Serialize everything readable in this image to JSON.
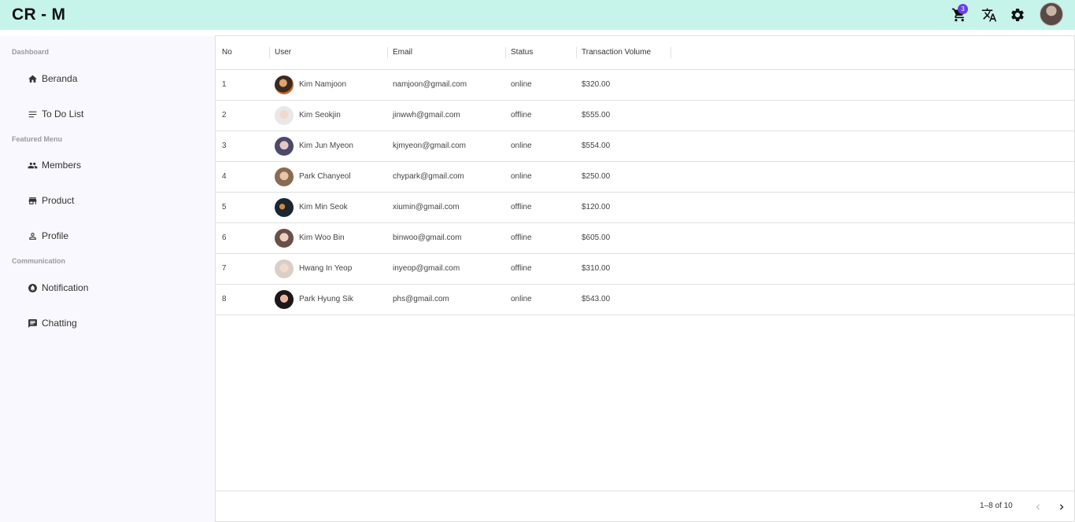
{
  "app": {
    "brand": "CR - M"
  },
  "header": {
    "cart_badge": "3"
  },
  "sidebar": {
    "sections": [
      {
        "title": "Dashboard"
      },
      {
        "title": "Featured Menu"
      },
      {
        "title": "Communication"
      }
    ],
    "items": [
      {
        "label": "Beranda",
        "icon": "home-icon"
      },
      {
        "label": "To Do List",
        "icon": "list-icon"
      },
      {
        "label": "Members",
        "icon": "people-icon"
      },
      {
        "label": "Product",
        "icon": "store-icon"
      },
      {
        "label": "Profile",
        "icon": "person-icon"
      },
      {
        "label": "Notification",
        "icon": "notification-icon"
      },
      {
        "label": "Chatting",
        "icon": "chat-icon"
      }
    ]
  },
  "table": {
    "columns": [
      "No",
      "User",
      "Email",
      "Status",
      "Transaction Volume"
    ],
    "rows": [
      {
        "no": "1",
        "user": "Kim Namjoon",
        "email": "namjoon@gmail.com",
        "status": "online",
        "volume": "$320.00"
      },
      {
        "no": "2",
        "user": "Kim Seokjin",
        "email": "jinwwh@gmail.com",
        "status": "offline",
        "volume": "$555.00"
      },
      {
        "no": "3",
        "user": "Kim Jun Myeon",
        "email": "kjmyeon@gmail.com",
        "status": "online",
        "volume": "$554.00"
      },
      {
        "no": "4",
        "user": "Park Chanyeol",
        "email": "chypark@gmail.com",
        "status": "online",
        "volume": "$250.00"
      },
      {
        "no": "5",
        "user": "Kim Min Seok",
        "email": "xiumin@gmail.com",
        "status": "offline",
        "volume": "$120.00"
      },
      {
        "no": "6",
        "user": "Kim Woo Bin",
        "email": "binwoo@gmail.com",
        "status": "offline",
        "volume": "$605.00"
      },
      {
        "no": "7",
        "user": "Hwang In Yeop",
        "email": "inyeop@gmail.com",
        "status": "offline",
        "volume": "$310.00"
      },
      {
        "no": "8",
        "user": "Park Hyung Sik",
        "email": "phs@gmail.com",
        "status": "online",
        "volume": "$543.00"
      }
    ],
    "pagination": "1–8 of 10"
  },
  "colors": {
    "header_bg": "#c6f4ea",
    "sidebar_bg": "#f8f8fe",
    "badge": "#6a3de8"
  }
}
